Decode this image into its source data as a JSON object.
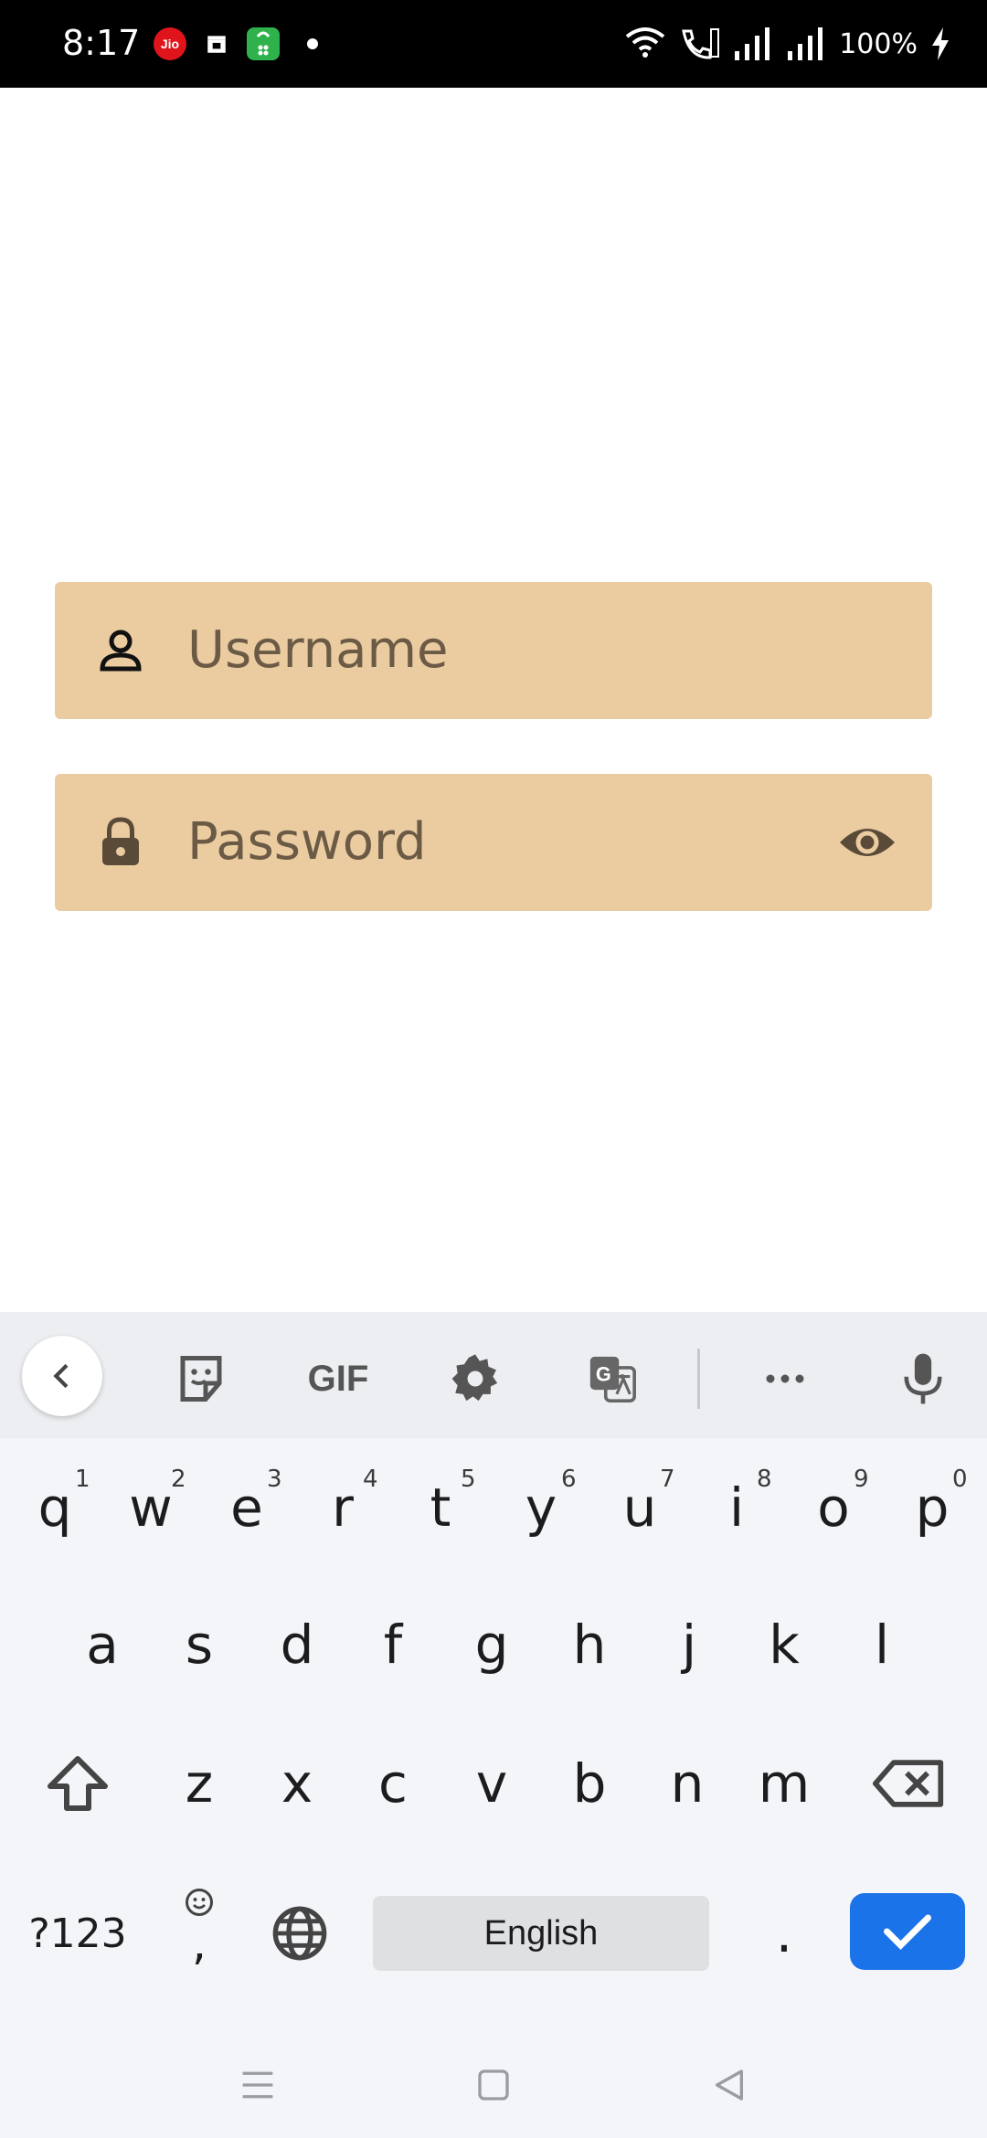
{
  "status_bar": {
    "time": "8:17",
    "jio_label": "Jio",
    "battery": "100%",
    "icons": [
      "jio-icon",
      "clapper-icon",
      "shopping-bag-icon",
      "dot-icon",
      "wifi-icon",
      "wifi-calling-icon",
      "signal-icon",
      "signal-icon",
      "charging-icon"
    ]
  },
  "form": {
    "username": {
      "placeholder": "Username",
      "icon": "person-icon"
    },
    "password": {
      "placeholder": "Password",
      "icon": "lock-icon",
      "toggle_icon": "eye-icon"
    },
    "field_color": "#ebcca1"
  },
  "keyboard": {
    "toolbar": [
      "back-icon",
      "sticker-icon",
      "gif-icon",
      "settings-icon",
      "translate-icon",
      "more-icon",
      "mic-icon"
    ],
    "gif_label": "GIF",
    "row1": [
      "q",
      "w",
      "e",
      "r",
      "t",
      "y",
      "u",
      "i",
      "o",
      "p"
    ],
    "row1_hints": [
      "1",
      "2",
      "3",
      "4",
      "5",
      "6",
      "7",
      "8",
      "9",
      "0"
    ],
    "row2": [
      "a",
      "s",
      "d",
      "f",
      "g",
      "h",
      "j",
      "k",
      "l"
    ],
    "row3": [
      "z",
      "x",
      "c",
      "v",
      "b",
      "n",
      "m"
    ],
    "symbols_label": "?123",
    "comma": ",",
    "space_label": "English",
    "period": ".",
    "enter_color": "#1a73e8"
  }
}
